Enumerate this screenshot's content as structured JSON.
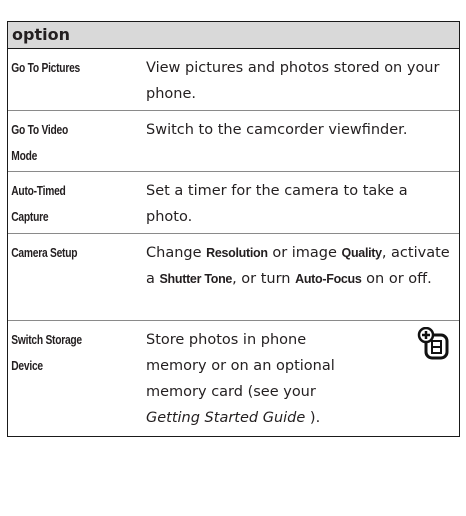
{
  "header": {
    "title": "option"
  },
  "rows": [
    {
      "option": "Go To Pictures",
      "desc": "View pictures and photos stored on your phone."
    },
    {
      "option_line1": "Go To Video",
      "option_line2": "Mode",
      "desc": "Switch to the camcorder viewfinder."
    },
    {
      "option_line1": "Auto-Timed",
      "option_line2": "Capture",
      "desc": "Set a timer for the camera to take a photo."
    },
    {
      "option": "Camera Setup",
      "desc_parts": {
        "p1": "Change ",
        "kw1": "Resolution",
        "p2": " or image ",
        "kw2": "Quality",
        "p3": ", activate a ",
        "kw3": "Shutter Tone",
        "p4": ", or turn ",
        "kw4": "Auto-Focus",
        "p5": " on or off."
      }
    },
    {
      "option_line1": "Switch Storage",
      "option_line2": "Device",
      "desc_lines": [
        "Store photos in phone",
        "memory or on an optional",
        "memory card (see your"
      ],
      "desc_italic": "Getting Started Guide",
      "desc_end": " ).",
      "icon": "memory-card-add-icon"
    }
  ]
}
